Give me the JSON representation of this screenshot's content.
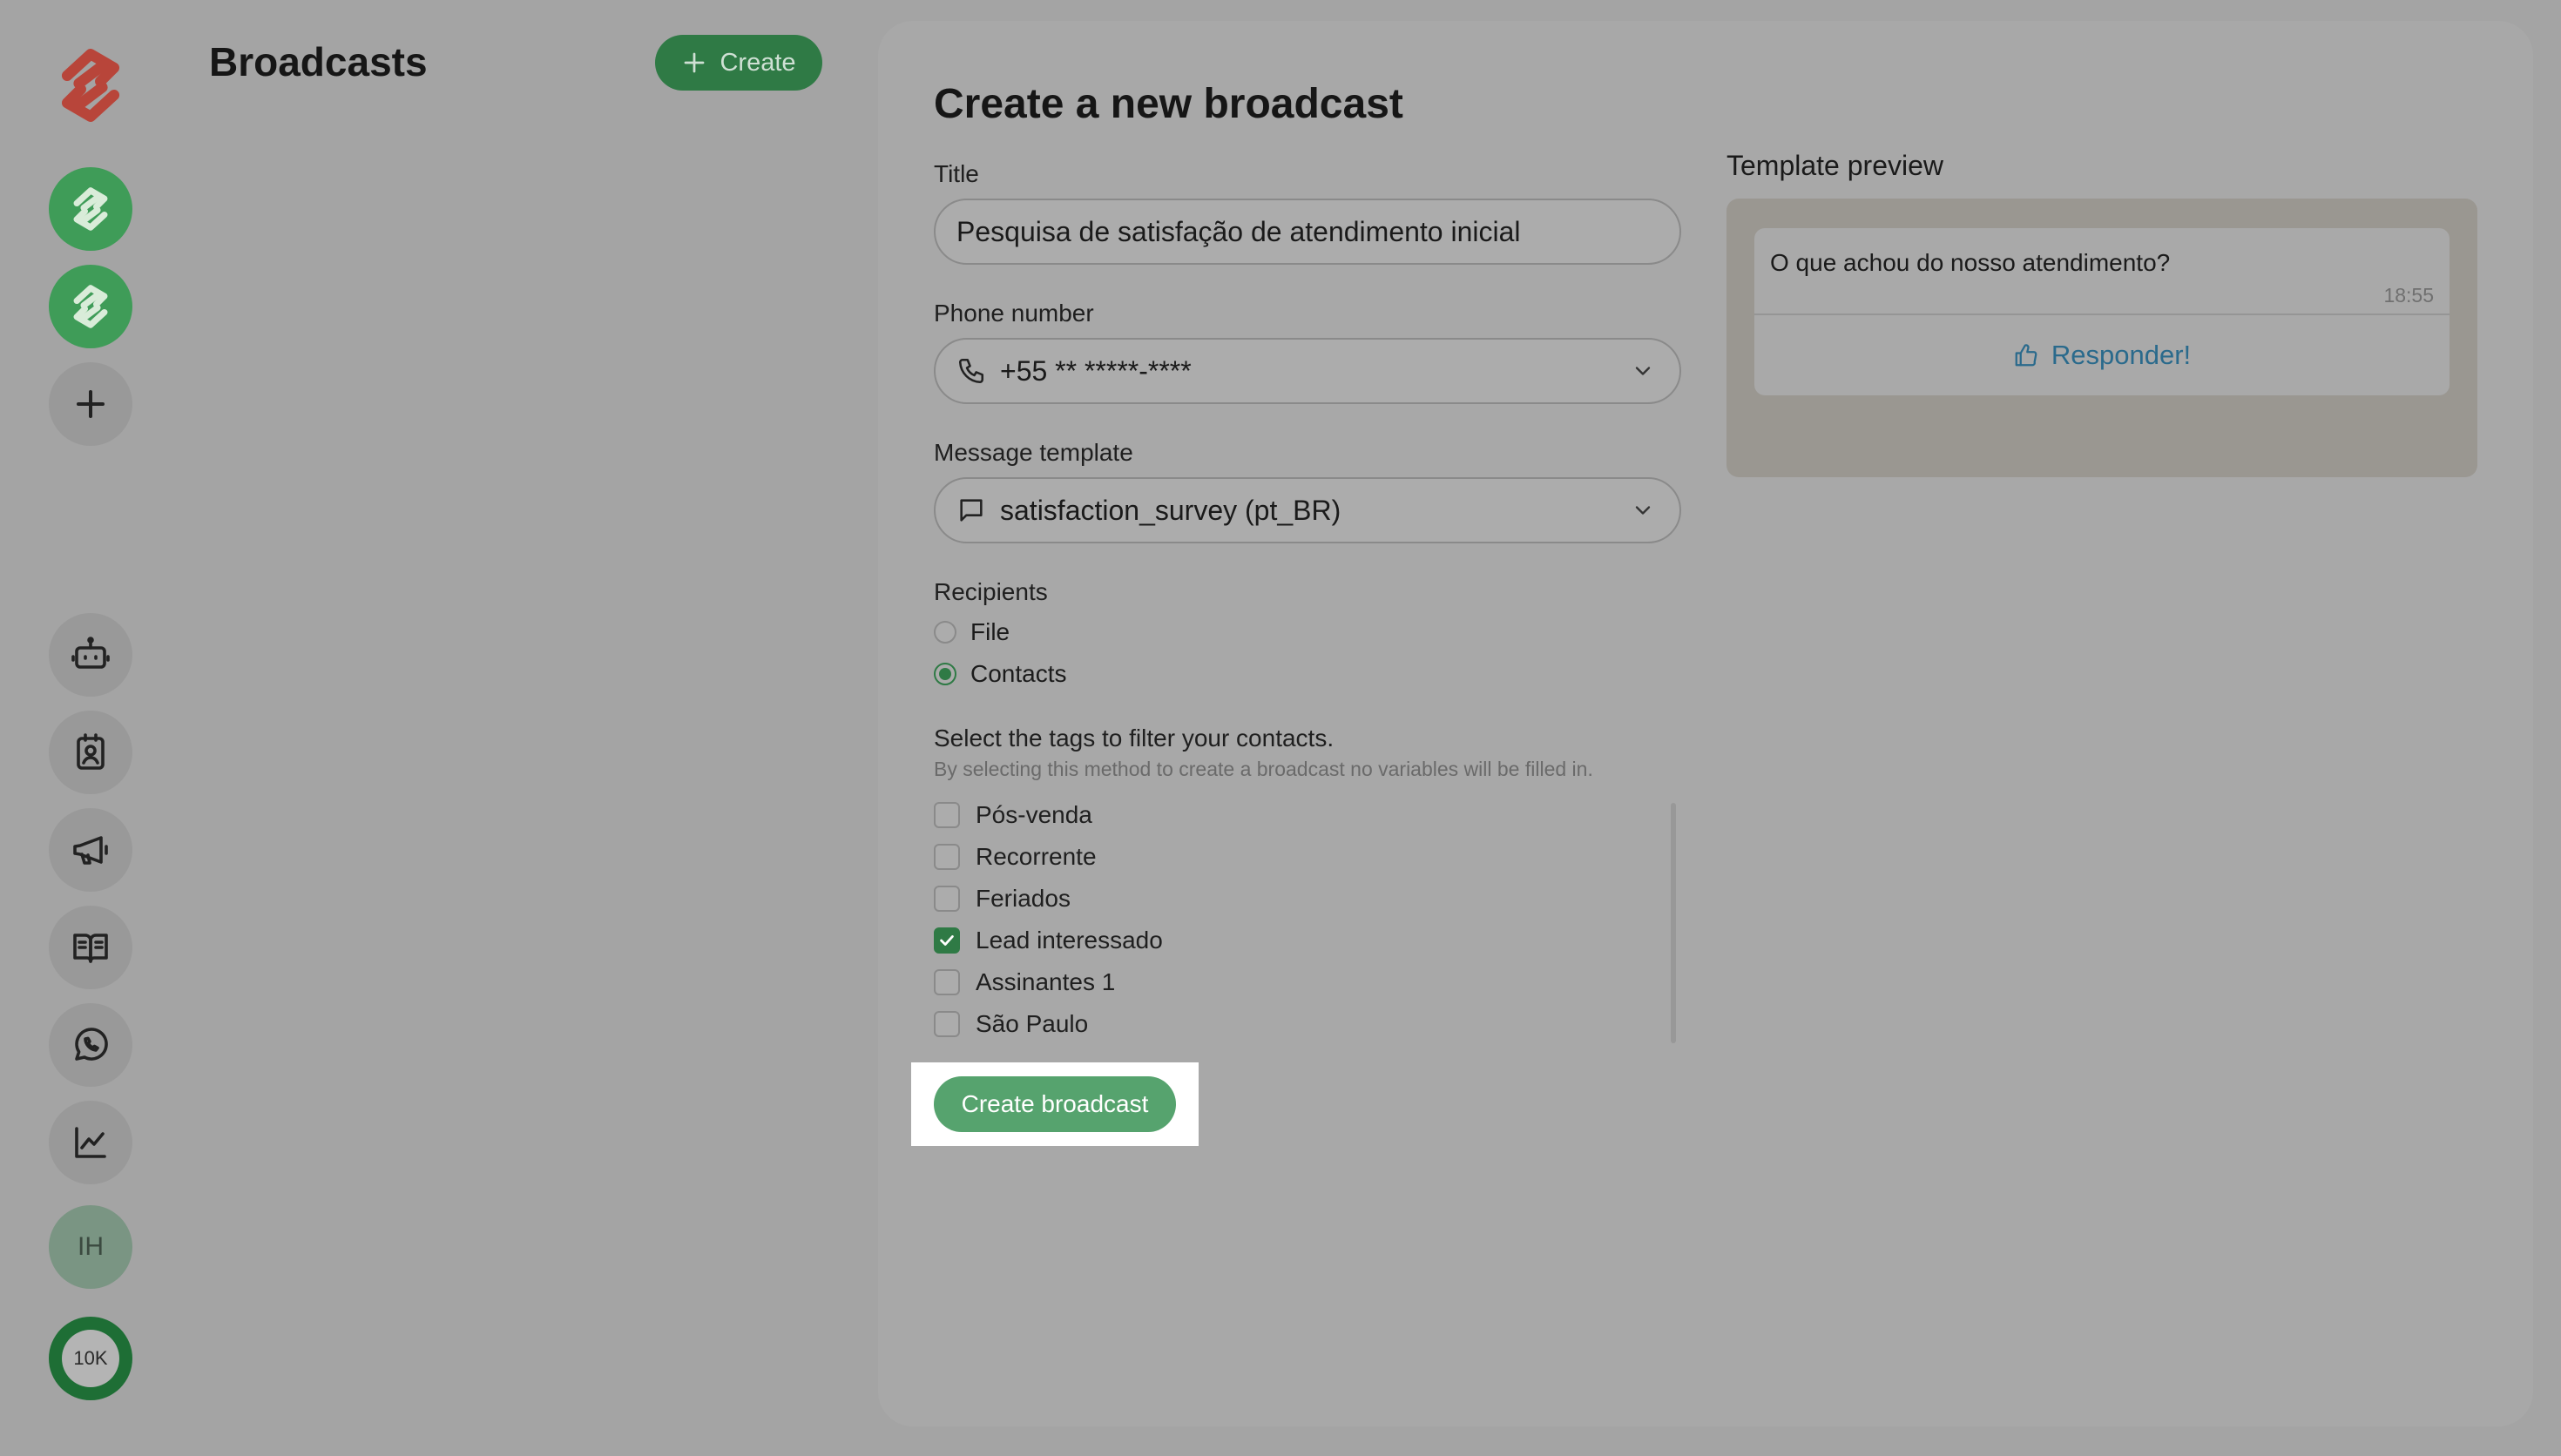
{
  "list": {
    "title": "Broadcasts",
    "create_label": "Create"
  },
  "sidebar": {
    "user_initials": "IH",
    "credits": "10K"
  },
  "form": {
    "heading": "Create a new broadcast",
    "title_label": "Title",
    "title_value": "Pesquisa de satisfação de atendimento inicial",
    "phone_label": "Phone number",
    "phone_value": "+55 ** *****-****",
    "template_label": "Message template",
    "template_value": "satisfaction_survey (pt_BR)",
    "recipients_label": "Recipients",
    "recipients_options": [
      {
        "label": "File",
        "selected": false
      },
      {
        "label": "Contacts",
        "selected": true
      }
    ],
    "tags_title": "Select the tags to filter your contacts.",
    "tags_hint": "By selecting this method to create a broadcast no variables will be filled in.",
    "tags": [
      {
        "label": "Pós-venda",
        "checked": false
      },
      {
        "label": "Recorrente",
        "checked": false
      },
      {
        "label": "Feriados",
        "checked": false
      },
      {
        "label": "Lead interessado",
        "checked": true
      },
      {
        "label": "Assinantes 1",
        "checked": false
      },
      {
        "label": "São Paulo",
        "checked": false
      }
    ],
    "submit_label": "Create broadcast"
  },
  "preview": {
    "title": "Template preview",
    "message": "O que achou do nosso atendimento?",
    "time": "18:55",
    "button_label": "Responder!"
  },
  "colors": {
    "brand_green": "#2f7a45",
    "submit_green": "#56a36e",
    "link_blue": "#2a6a8c",
    "logo_red": "#c0392b"
  }
}
